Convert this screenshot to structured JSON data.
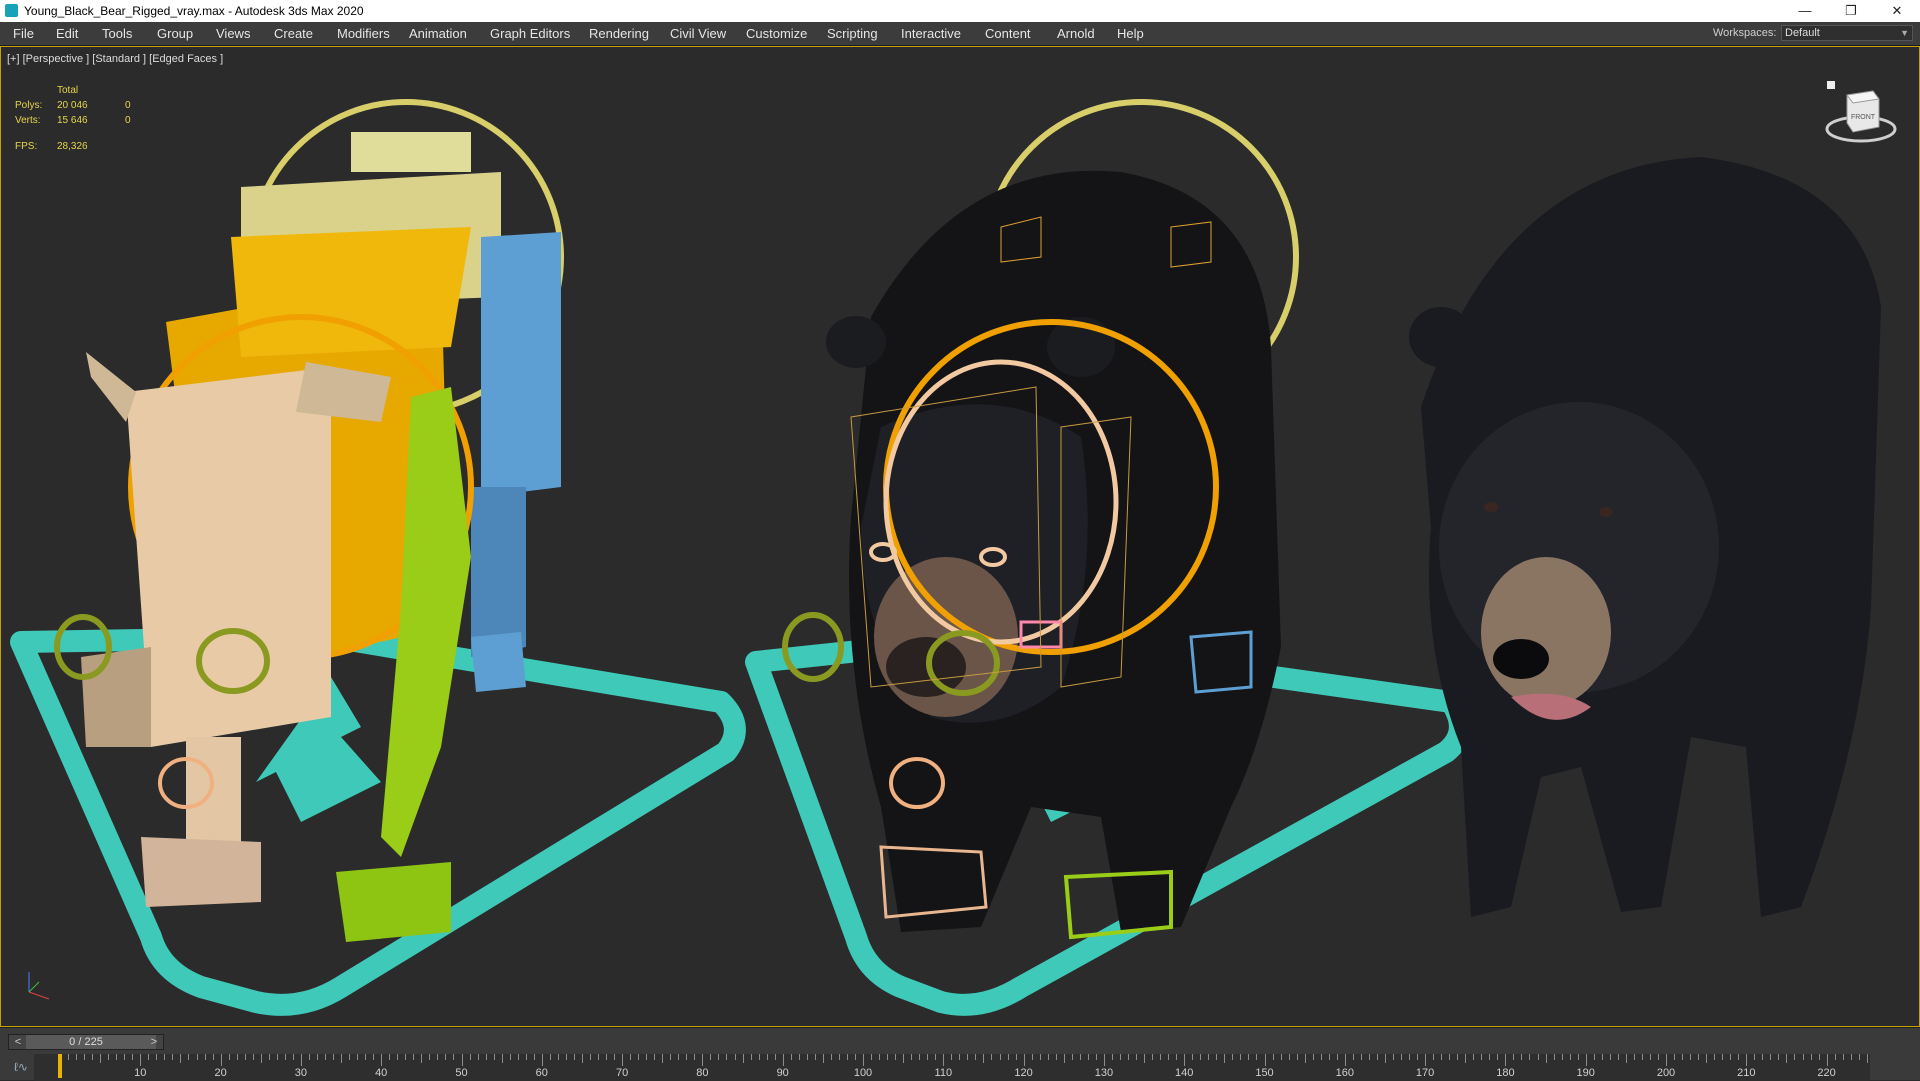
{
  "window": {
    "title": "Young_Black_Bear_Rigged_vray.max - Autodesk 3ds Max 2020",
    "minimize": "—",
    "restore": "❐",
    "close": "✕"
  },
  "menu": {
    "items": [
      "File",
      "Edit",
      "Tools",
      "Group",
      "Views",
      "Create",
      "Modifiers",
      "Animation",
      "Graph Editors",
      "Rendering",
      "Civil View",
      "Customize",
      "Scripting",
      "Interactive",
      "Content",
      "Arnold",
      "Help"
    ],
    "workspace_label": "Workspaces:",
    "workspace_value": "Default"
  },
  "viewport": {
    "label": "[+] [Perspective ] [Standard ] [Edged Faces ]",
    "stats": {
      "total_label": "Total",
      "polys_label": "Polys:",
      "polys_value": "20 046",
      "polys_sel": "0",
      "verts_label": "Verts:",
      "verts_value": "15 646",
      "verts_sel": "0",
      "fps_label": "FPS:",
      "fps_value": "28,326"
    },
    "viewcube_label": "FRONT"
  },
  "timeline": {
    "frame_display": "0 / 225",
    "prev": "<",
    "next": ">",
    "current_frame": 0,
    "frame_count": 225,
    "ruler_labels": [
      "10",
      "20",
      "30",
      "40",
      "50",
      "60",
      "70",
      "80",
      "90",
      "100",
      "110",
      "120",
      "130",
      "140",
      "150",
      "160",
      "170",
      "180",
      "190",
      "200",
      "210",
      "220"
    ]
  },
  "colors": {
    "accent": "#c4a000",
    "teal_control": "#3fc9b9",
    "yellow_ring": "#d8cf6a",
    "orange_ring": "#f0a000"
  }
}
